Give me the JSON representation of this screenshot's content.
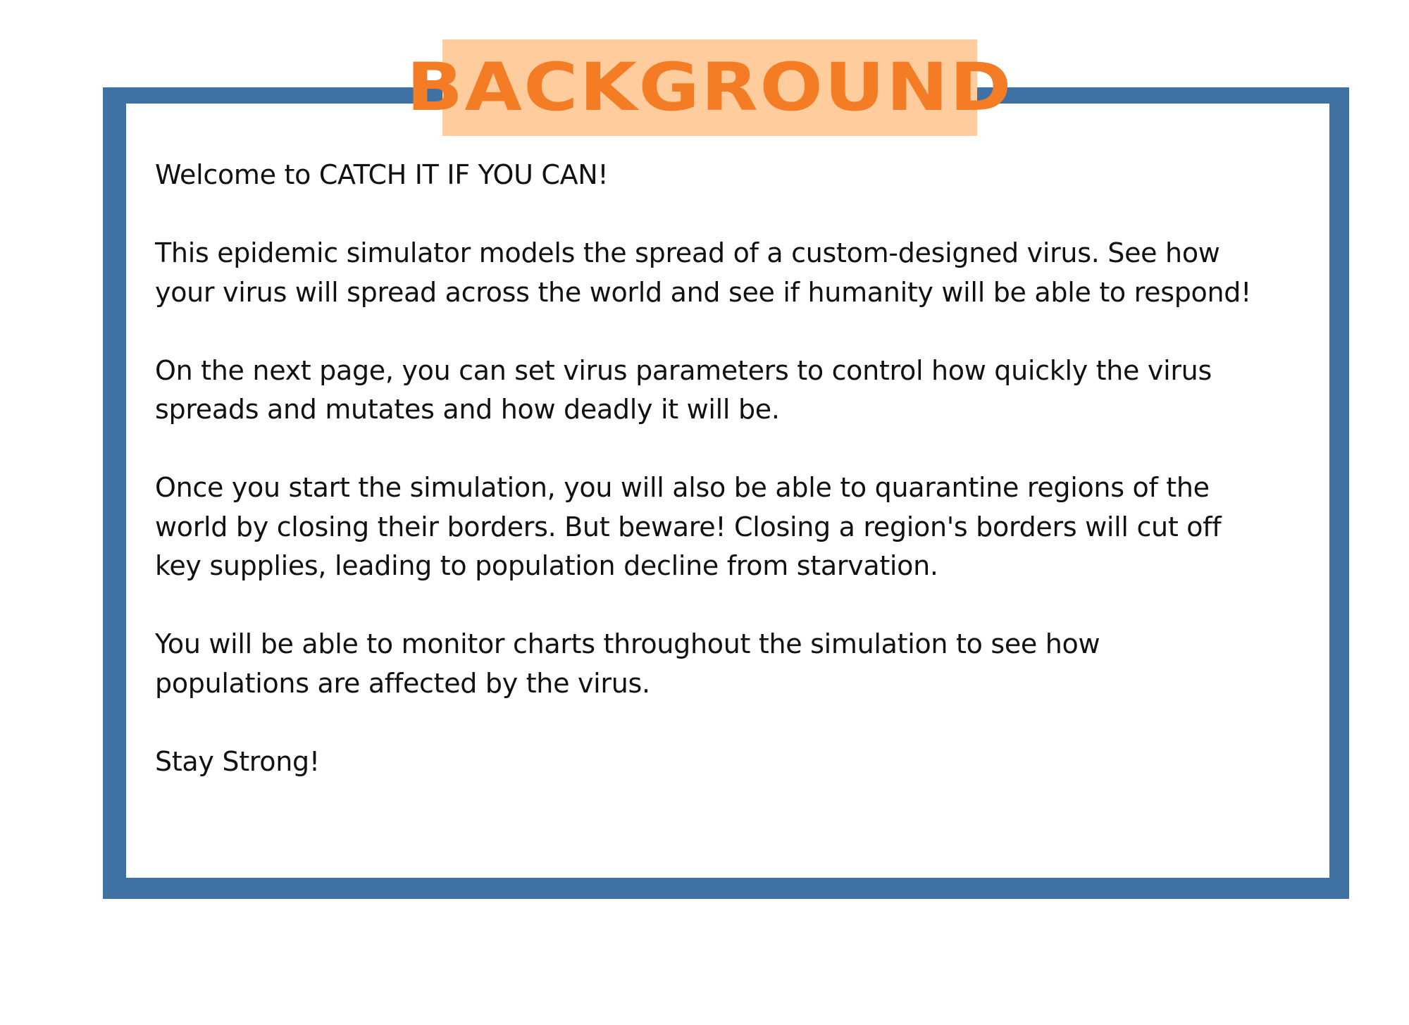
{
  "title": "BACKGROUND",
  "paragraphs": [
    "Welcome to CATCH IT IF YOU CAN!",
    "This epidemic simulator models the spread of a custom-designed virus. See how\nyour virus will spread across the world and see if humanity will be able to respond!",
    "On the next page, you can set virus parameters to control how quickly the virus\nspreads and mutates and how deadly it will be.",
    "Once you start the simulation, you will also be able to quarantine regions of the\nworld by closing their borders. But beware! Closing a region's borders will cut off\nkey supplies, leading to population decline from starvation.",
    "You will be able to monitor charts throughout the simulation to see how\npopulations are affected by the virus.",
    "Stay Strong!"
  ],
  "colors": {
    "frame_border": "#3f72a2",
    "title_background": "#ffcc9e",
    "title_text": "#f47c24",
    "body_text": "#111111"
  }
}
